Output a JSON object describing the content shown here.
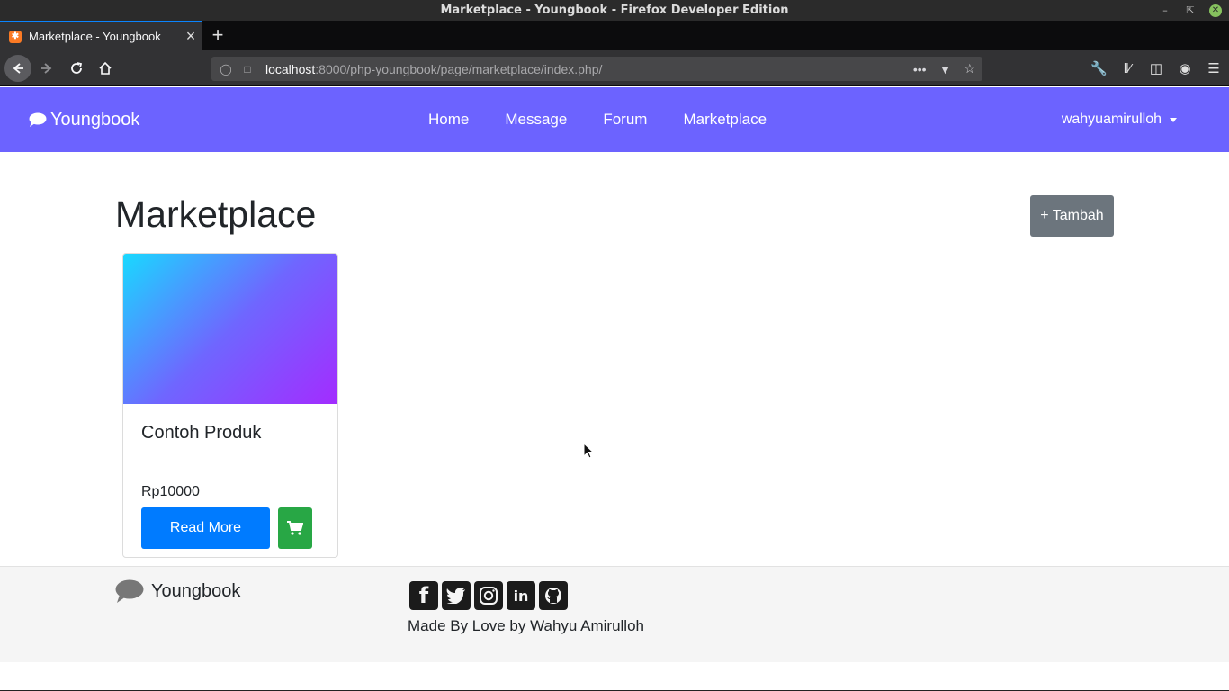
{
  "window": {
    "title": "Marketplace - Youngbook - Firefox Developer Edition"
  },
  "browser": {
    "tab_title": "Marketplace - Youngbook",
    "url_host": "localhost",
    "url_rest": ":8000/php-youngbook/page/marketplace/index.php/"
  },
  "navbar": {
    "brand": "Youngbook",
    "links": [
      "Home",
      "Message",
      "Forum",
      "Marketplace"
    ],
    "user": "wahyuamirulloh"
  },
  "main": {
    "title": "Marketplace",
    "add_button": "+ Tambah"
  },
  "product": {
    "name": "Contoh Produk",
    "price": "Rp10000",
    "read_more": "Read More"
  },
  "footer": {
    "brand": "Youngbook",
    "social_icons": [
      "facebook-icon",
      "twitter-icon",
      "instagram-icon",
      "linkedin-icon",
      "github-icon"
    ],
    "credit": "Made By Love by Wahyu Amirulloh"
  },
  "colors": {
    "navbar_bg": "#6c63ff",
    "read_more_bg": "#007bff",
    "cart_bg": "#28a745",
    "add_bg": "#6c757d"
  }
}
